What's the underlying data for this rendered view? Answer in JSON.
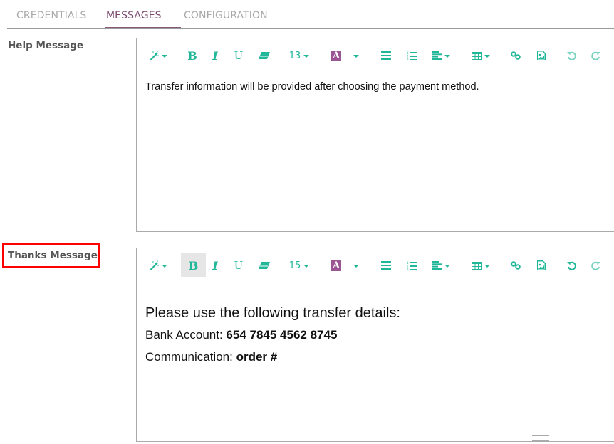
{
  "tabs": [
    {
      "label": "CREDENTIALS",
      "active": false
    },
    {
      "label": "MESSAGES",
      "active": true
    },
    {
      "label": "CONFIGURATION",
      "active": false
    }
  ],
  "colors": {
    "accent": "#875a7b",
    "toolbar_icon": "#21b799",
    "font_color_swatch": "#9b5593",
    "highlight_box": "#ff0000"
  },
  "fields": {
    "help": {
      "label": "Help Message",
      "toolbar": {
        "style_icon": "magic-wand-icon",
        "bold": "B",
        "italic": "I",
        "underline": "U",
        "eraser_icon": "eraser-icon",
        "font_size": "13",
        "font_color": "A",
        "bold_active": false,
        "undo_enabled": false
      },
      "content": {
        "line1": "Transfer information will be provided after choosing the payment method."
      }
    },
    "thanks": {
      "label": "Thanks Message",
      "highlighted": true,
      "toolbar": {
        "style_icon": "magic-wand-icon",
        "bold": "B",
        "italic": "I",
        "underline": "U",
        "eraser_icon": "eraser-icon",
        "font_size": "15",
        "font_color": "A",
        "bold_active": true,
        "undo_enabled": true
      },
      "content": {
        "heading": "Please use the following transfer details:",
        "bank_label": "Bank Account: ",
        "bank_value": "654 7845 4562 8745",
        "comm_label": "Communication: ",
        "comm_value": "order #"
      }
    }
  }
}
